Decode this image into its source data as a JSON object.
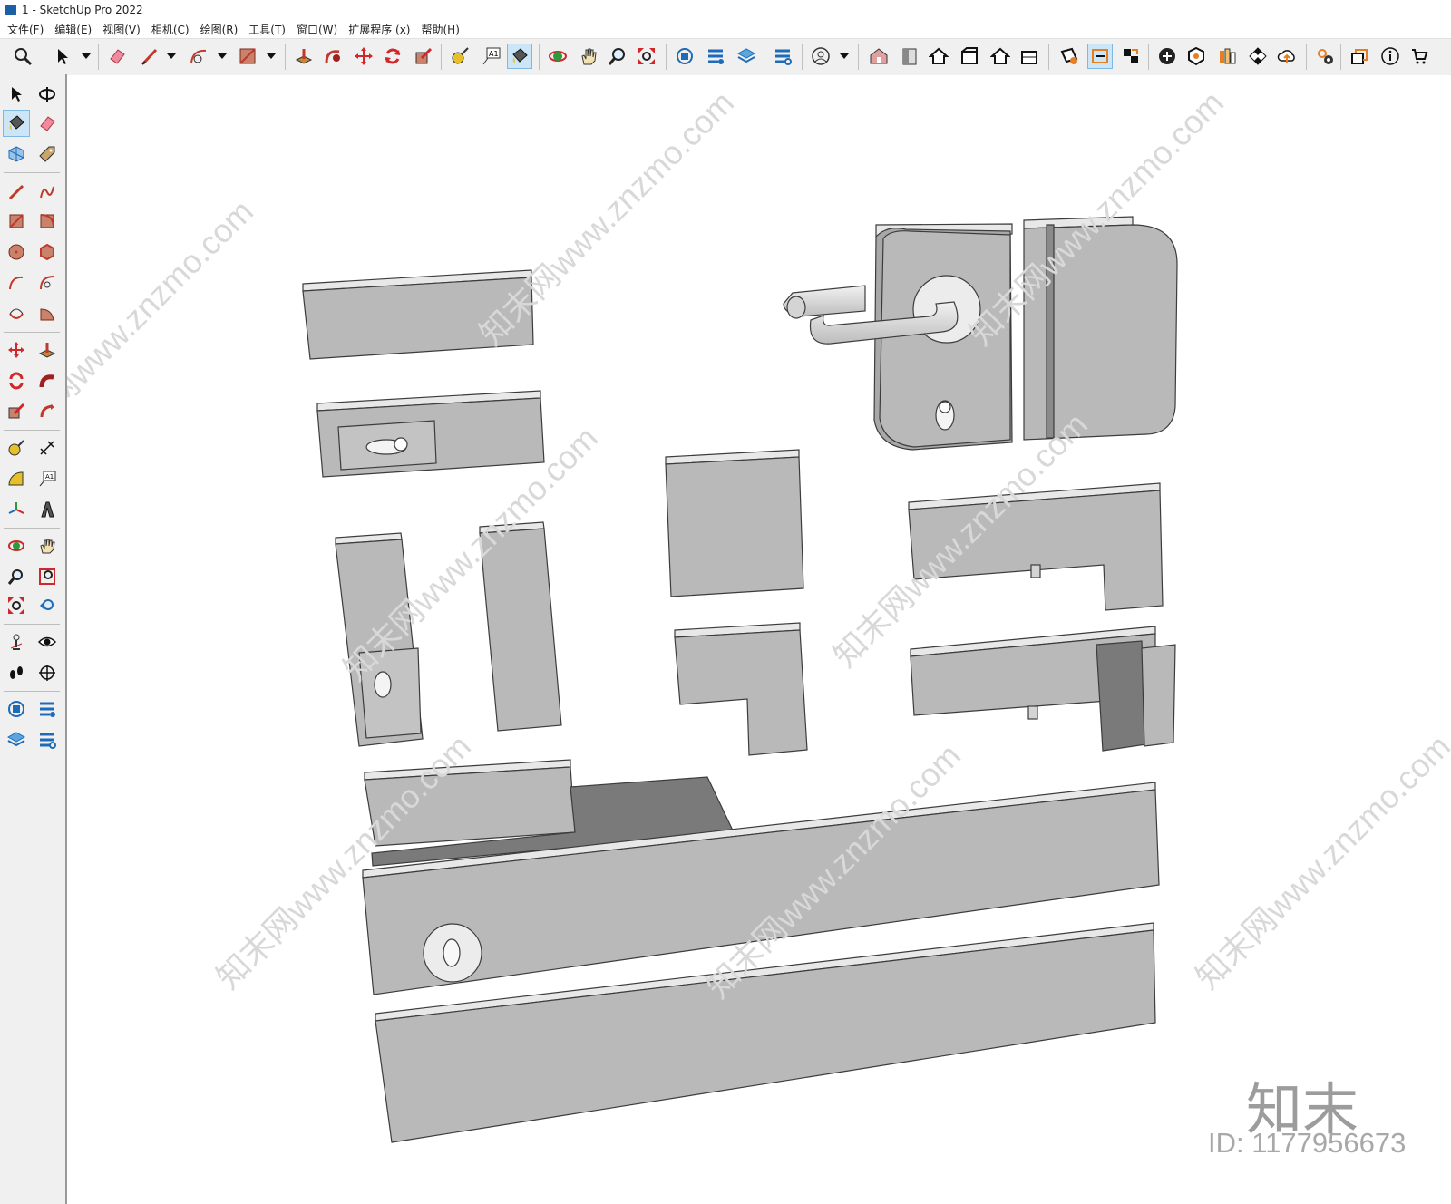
{
  "window": {
    "title": "1 - SketchUp Pro 2022"
  },
  "menu": [
    "文件(F)",
    "编辑(E)",
    "视图(V)",
    "相机(C)",
    "绘图(R)",
    "工具(T)",
    "窗口(W)",
    "扩展程序 (x)",
    "帮助(H)"
  ],
  "toolbar": {
    "icons": [
      "zoom-icon",
      "select-icon",
      "eraser-icon",
      "pencil-icon",
      "arc-icon",
      "rectangle-icon",
      "push-pull-icon",
      "follow-me-icon",
      "move-icon",
      "rotate-icon",
      "scale-icon",
      "tape-measure-icon",
      "text-label-icon",
      "paint-bucket-icon",
      "orbit-icon",
      "pan-icon",
      "zoom-tool-icon",
      "zoom-extents-icon",
      "warehouse-icon",
      "extension-warehouse-icon",
      "layout-icon",
      "extension-manager-icon",
      "user-icon",
      "iso-view-icon",
      "front-view-icon",
      "top-view-icon",
      "right-view-icon",
      "back-view-icon",
      "left-view-icon",
      "section-plane-icon",
      "section-fill-icon",
      "section-display-icon",
      "add-location-icon",
      "solid-tools-icon",
      "styles-icon",
      "texture-icon",
      "cloud-upload-icon",
      "settings-icon",
      "views-icon",
      "info-icon"
    ]
  },
  "left_toolbar": {
    "icons": [
      "select-icon",
      "orbit-icon",
      "paint-bucket-icon",
      "eraser-icon",
      "component-icon",
      "tag-icon",
      "pencil-icon",
      "freehand-icon",
      "rectangle-icon",
      "rotated-rectangle-icon",
      "circle-icon",
      "polygon-icon",
      "arc-icon",
      "two-point-arc-icon",
      "three-point-arc-icon",
      "pie-icon",
      "move-icon",
      "push-pull-icon",
      "rotate-icon",
      "follow-me-icon",
      "scale-icon",
      "offset-icon",
      "tape-measure-icon",
      "dimension-icon",
      "protractor-icon",
      "text-icon",
      "axes-icon",
      "3d-text-icon",
      "orbit-tool-icon",
      "pan-icon",
      "zoom-icon",
      "zoom-window-icon",
      "zoom-extents-icon",
      "previous-view-icon",
      "position-camera-icon",
      "look-around-icon",
      "walk-icon",
      "section-plane-icon",
      "warehouse-icon",
      "extension-warehouse-icon",
      "layout-icon",
      "extension-manager-icon"
    ]
  },
  "watermark": {
    "brand": "知末",
    "id_text": "ID: 1177956673",
    "site": "知末网www.znzmo.com"
  },
  "colors": {
    "part_fill": "#b9b9b9",
    "part_edge": "#3c3c3c",
    "part_highlight": "#e8e8e8",
    "plate_dark": "#7a7a7a",
    "accent": "#cde6f7"
  }
}
